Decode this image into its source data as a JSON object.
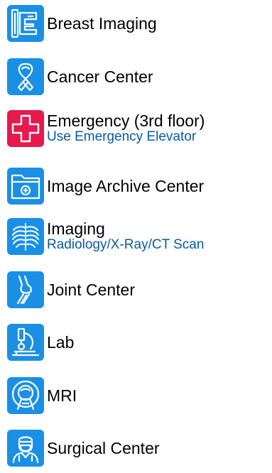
{
  "departments": [
    {
      "name": "Breast Imaging",
      "icon": "mammography-icon",
      "color": "#1a8fe6"
    },
    {
      "name": "Cancer Center",
      "icon": "awareness-ribbon-icon",
      "color": "#1a8fe6"
    },
    {
      "name": "Emergency (3rd floor)",
      "subtitle": "Use Emergency Elevator",
      "icon": "medical-cross-icon",
      "color": "#e8194d"
    },
    {
      "name": "Image Archive Center",
      "icon": "folder-archive-icon",
      "color": "#1a8fe6"
    },
    {
      "name": "Imaging",
      "subtitle": "Radiology/X-Ray/CT Scan",
      "icon": "ribcage-xray-icon",
      "color": "#1a8fe6"
    },
    {
      "name": "Joint Center",
      "icon": "knee-joint-icon",
      "color": "#1a8fe6"
    },
    {
      "name": "Lab",
      "icon": "microscope-icon",
      "color": "#1a8fe6"
    },
    {
      "name": "MRI",
      "icon": "mri-scanner-icon",
      "color": "#1a8fe6"
    },
    {
      "name": "Surgical Center",
      "icon": "surgeon-icon",
      "color": "#1a8fe6"
    }
  ],
  "subtitle_color": "#0a59a5"
}
